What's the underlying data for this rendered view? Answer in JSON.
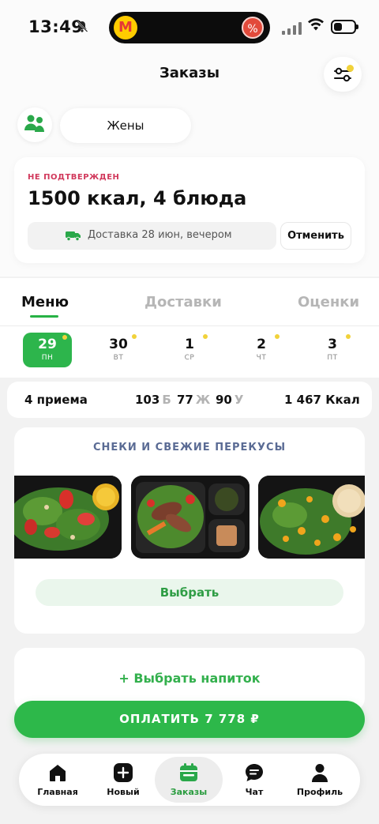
{
  "status_bar": {
    "time": "13:49",
    "promo_symbol": "%",
    "brand_letter": "M"
  },
  "header": {
    "title": "Заказы"
  },
  "profile": {
    "name": "Жены"
  },
  "order": {
    "status": "НЕ ПОДТВЕРЖДЕН",
    "summary": "1500 ккал, 4 блюда",
    "delivery": "Доставка 28 июн, вечером",
    "cancel_label": "Отменить"
  },
  "tabs": [
    {
      "label": "Меню",
      "active": true
    },
    {
      "label": "Доставки",
      "active": false
    },
    {
      "label": "Оценки",
      "active": false
    }
  ],
  "days": [
    {
      "num": "29",
      "wd": "ПН",
      "active": true
    },
    {
      "num": "30",
      "wd": "ВТ",
      "active": false
    },
    {
      "num": "1",
      "wd": "СР",
      "active": false
    },
    {
      "num": "2",
      "wd": "ЧТ",
      "active": false
    },
    {
      "num": "3",
      "wd": "ПТ",
      "active": false
    }
  ],
  "nutrition": {
    "meals": "4 приема",
    "protein": {
      "value": "103",
      "unit": "Б"
    },
    "fat": {
      "value": "77",
      "unit": "Ж"
    },
    "carbs": {
      "value": "90",
      "unit": "У"
    },
    "kcal": "1 467 Ккал"
  },
  "snacks": {
    "title": "СНЕКИ И СВЕЖИЕ ПЕРЕКУСЫ",
    "choose_label": "Выбрать"
  },
  "drink": {
    "label": "+ Выбрать напиток"
  },
  "pay": {
    "label": "ОПЛАТИТЬ 7 778 ₽"
  },
  "nav": [
    {
      "label": "Главная",
      "icon": "home-icon",
      "active": false
    },
    {
      "label": "Новый",
      "icon": "plus-icon",
      "active": false
    },
    {
      "label": "Заказы",
      "icon": "calendar-icon",
      "active": true
    },
    {
      "label": "Чат",
      "icon": "chat-icon",
      "active": false
    },
    {
      "label": "Профиль",
      "icon": "profile-icon",
      "active": false
    }
  ],
  "colors": {
    "accent": "#2db84a",
    "status_red": "#d1395c",
    "dot_yellow": "#f1d23a"
  }
}
